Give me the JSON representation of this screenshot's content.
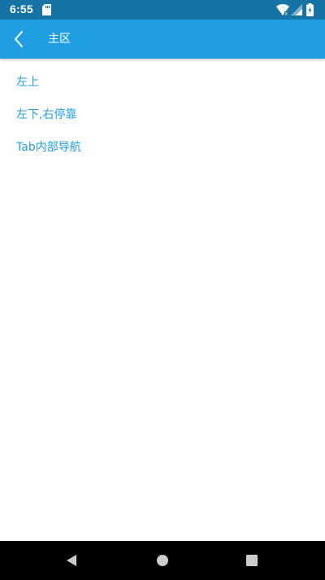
{
  "status_bar": {
    "time": "6:55",
    "icons": [
      "sd-card-icon",
      "wifi-icon",
      "signal-icon",
      "battery-icon"
    ]
  },
  "app_bar": {
    "title": "主区",
    "back_icon": "chevron-left-icon"
  },
  "menu": {
    "items": [
      {
        "label": "左上"
      },
      {
        "label": "左下,右停靠"
      },
      {
        "label": "Tab内部导航"
      }
    ]
  },
  "nav_bar": {
    "buttons": [
      "back-triangle-icon",
      "home-circle-icon",
      "recents-square-icon"
    ]
  },
  "colors": {
    "status_bar": "#1673a6",
    "app_bar": "#1f9fe2",
    "link": "#1f9fe2",
    "nav_bar": "#000000"
  }
}
